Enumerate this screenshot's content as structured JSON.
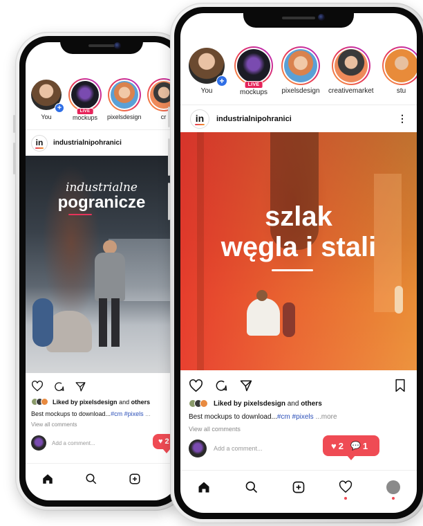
{
  "colors": {
    "accent_red": "#ef4b54",
    "story_ring_start": "#f9a13a",
    "story_ring_end": "#b02ad1",
    "hashtag_blue": "#2b4fb8"
  },
  "back_phone": {
    "stories": [
      {
        "label": "You",
        "badge": "+"
      },
      {
        "label": "mockups",
        "live": "LIVE"
      },
      {
        "label": "pixelsdesign"
      },
      {
        "label": "cr"
      }
    ],
    "post": {
      "logo": "in",
      "username": "industrialnipohranici",
      "title_script": "industrialne",
      "title_bold": "pogranicze"
    },
    "liked_by_prefix": "Liked by",
    "liked_by_user": "pixelsdesign",
    "liked_by_and": "and",
    "liked_by_others": "others",
    "caption_text": "Best mockups to download...",
    "caption_tags": "#cm #pixels",
    "caption_more": "...",
    "view_all": "View all comments",
    "add_comment": "Add a comment...",
    "notif_likes": "2"
  },
  "front_phone": {
    "stories": [
      {
        "label": "You",
        "badge": "+"
      },
      {
        "label": "mockups",
        "live": "LIVE"
      },
      {
        "label": "pixelsdesign"
      },
      {
        "label": "creativemarket"
      },
      {
        "label": "stu"
      }
    ],
    "post": {
      "logo": "in",
      "username": "industrialnipohranici",
      "more": "⋮",
      "title_line1": "szlak",
      "title_line2": "węgla i stali"
    },
    "liked_by_prefix": "Liked by",
    "liked_by_user": "pixelsdesign",
    "liked_by_and": "and",
    "liked_by_others": "others",
    "caption_text": "Best mockups to download...",
    "caption_tags": "#cm #pixels",
    "caption_more": "...more",
    "view_all": "View all comments",
    "add_comment": "Add a comment...",
    "notif_likes": "2",
    "notif_comments": "1"
  }
}
